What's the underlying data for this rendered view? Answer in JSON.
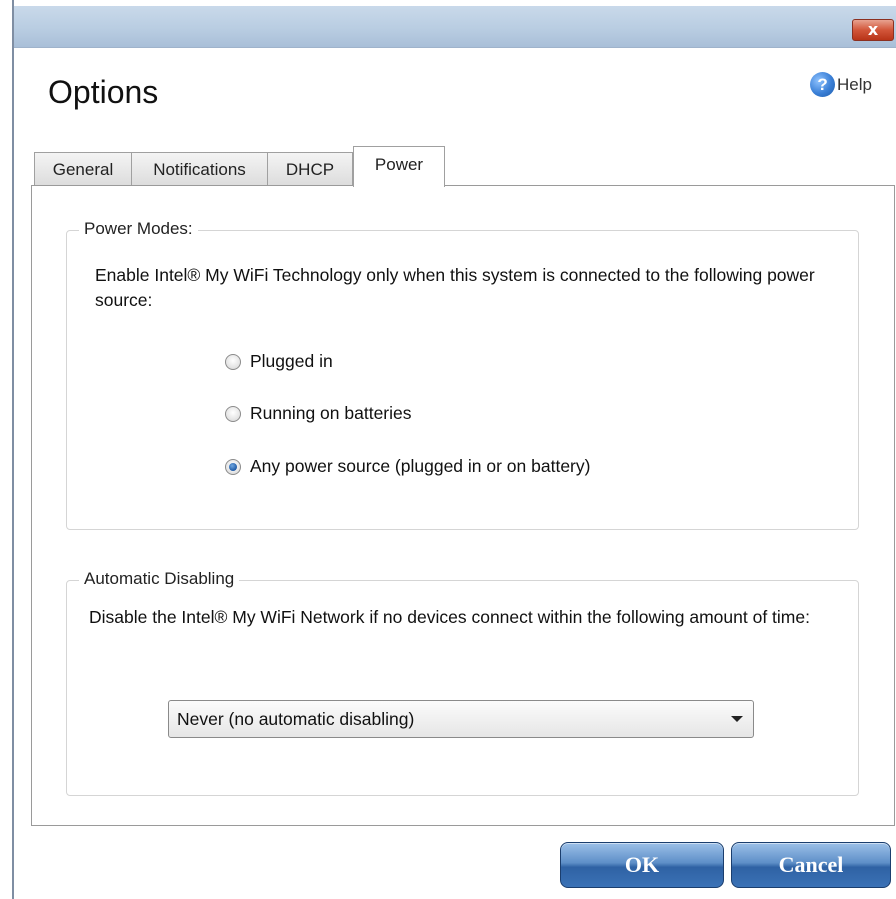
{
  "window": {
    "close_label": "x"
  },
  "header": {
    "title": "Options",
    "help_icon_glyph": "?",
    "help_label": "Help"
  },
  "tabs": [
    {
      "label": "General"
    },
    {
      "label": "Notifications"
    },
    {
      "label": "DHCP"
    },
    {
      "label": "Power",
      "active": true
    }
  ],
  "power_modes": {
    "legend": "Power Modes:",
    "description": "Enable Intel® My WiFi Technology only when this system is connected to the following power source:",
    "options": [
      {
        "label": "Plugged in",
        "checked": false
      },
      {
        "label": "Running on batteries",
        "checked": false
      },
      {
        "label": "Any power source (plugged in or on battery)",
        "checked": true
      }
    ]
  },
  "auto_disable": {
    "legend": "Automatic Disabling",
    "description": "Disable the Intel® My WiFi Network if no devices connect within the following amount of time:",
    "selected": "Never (no automatic disabling)"
  },
  "buttons": {
    "ok": "OK",
    "cancel": "Cancel"
  },
  "colors": {
    "titlebar": "#b9cde2",
    "button_blue": "#2f62a4",
    "close_red": "#d2563a"
  }
}
